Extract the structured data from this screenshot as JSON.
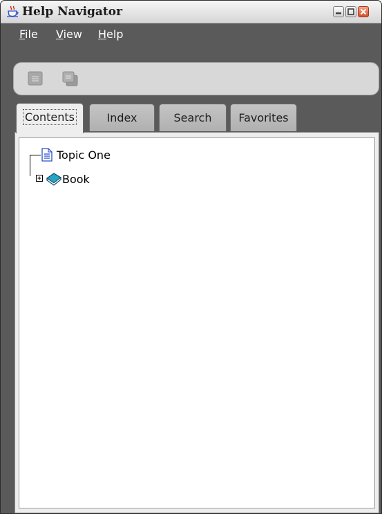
{
  "window": {
    "title": "Help Navigator",
    "app_icon": "java-coffee-icon",
    "controls": [
      "minimize-icon",
      "maximize-icon",
      "close-icon"
    ]
  },
  "menubar": {
    "items": [
      {
        "label": "File",
        "mnemonic": "F",
        "rest": "ile"
      },
      {
        "label": "View",
        "mnemonic": "V",
        "rest": "iew"
      },
      {
        "label": "Help",
        "mnemonic": "H",
        "rest": "elp"
      }
    ]
  },
  "toolbar": {
    "buttons": [
      {
        "icon": "previous-page-icon",
        "enabled": false
      },
      {
        "icon": "print-icon",
        "enabled": false
      }
    ]
  },
  "tabs": {
    "selected": "Contents",
    "items": [
      {
        "label": "Contents"
      },
      {
        "label": "Index"
      },
      {
        "label": "Search"
      },
      {
        "label": "Favorites"
      }
    ]
  },
  "tree": {
    "nodes": [
      {
        "label": "Topic One",
        "icon": "topic-page-icon"
      },
      {
        "label": "Book",
        "icon": "book-icon",
        "expanded": false
      }
    ]
  },
  "colors": {
    "window_background": "#5a5a5a",
    "panel_background": "#eeeeee",
    "tree_background": "#ffffff",
    "topic_icon_blue": "#2a4fc8",
    "book_icon_teal": "#27a6c4"
  }
}
